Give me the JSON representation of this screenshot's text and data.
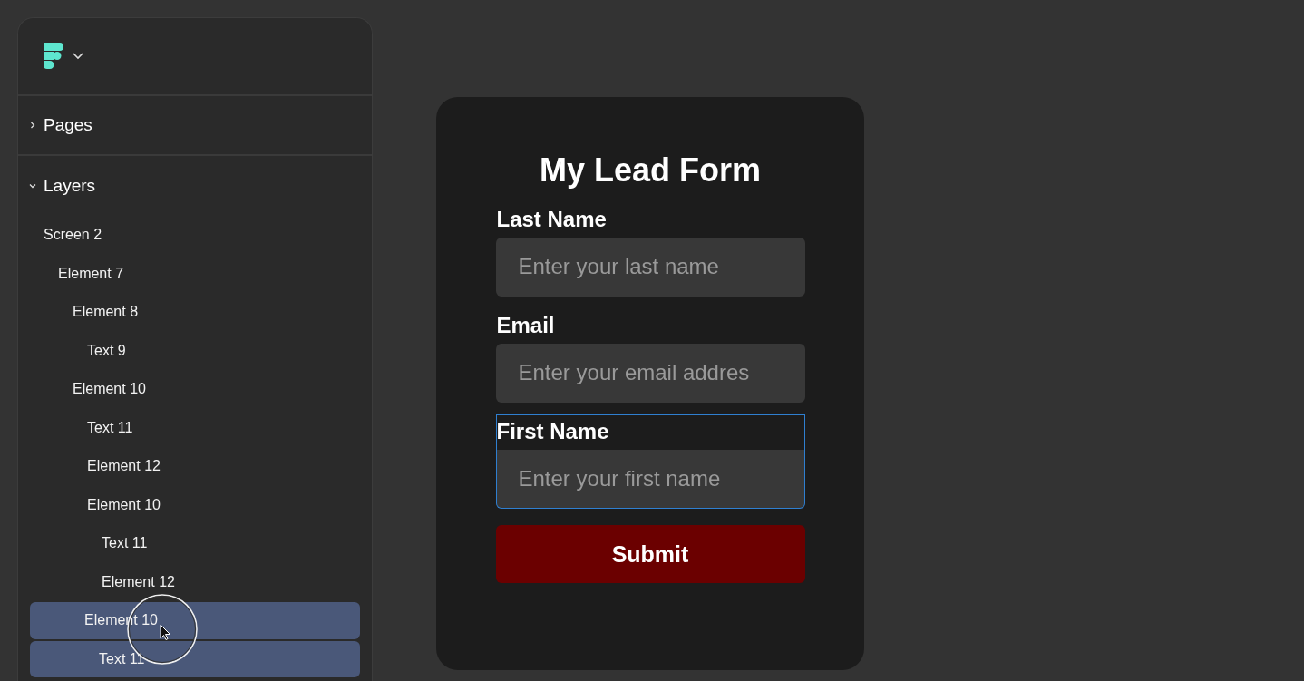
{
  "sidebar": {
    "sections": [
      {
        "label": "Pages",
        "expanded": false
      },
      {
        "label": "Layers",
        "expanded": true
      }
    ],
    "layers": [
      {
        "label": "Screen 2",
        "selected": false,
        "children": [
          {
            "label": "Element 7",
            "selected": false,
            "children": [
              {
                "label": "Element 8",
                "selected": false,
                "children": [
                  {
                    "label": "Text 9",
                    "selected": false
                  }
                ]
              },
              {
                "label": "Element 10",
                "selected": false,
                "children": [
                  {
                    "label": "Text 11",
                    "selected": false
                  },
                  {
                    "label": "Element 12",
                    "selected": false
                  },
                  {
                    "label": "Element 10",
                    "selected": false,
                    "children": [
                      {
                        "label": "Text 11",
                        "selected": false
                      },
                      {
                        "label": "Element 12",
                        "selected": false
                      }
                    ]
                  }
                ]
              },
              {
                "label": "Element 10",
                "selected": true,
                "children": [
                  {
                    "label": "Text 11",
                    "selected": true
                  }
                ]
              }
            ]
          }
        ]
      }
    ]
  },
  "form": {
    "title": "My Lead Form",
    "fields": [
      {
        "label": "Last Name",
        "placeholder": "Enter your last name",
        "selected": false
      },
      {
        "label": "Email",
        "placeholder": "Enter your email addres",
        "selected": false
      },
      {
        "label": "First Name",
        "placeholder": "Enter your first name",
        "selected": true
      }
    ],
    "button": "Submit"
  }
}
